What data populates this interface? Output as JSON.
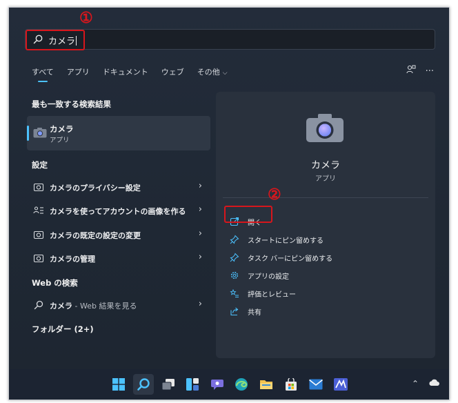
{
  "search": {
    "query": "カメラ"
  },
  "annotations": {
    "step1": "①",
    "step2": "②"
  },
  "tabs": [
    {
      "label": "すべて",
      "active": true
    },
    {
      "label": "アプリ"
    },
    {
      "label": "ドキュメント"
    },
    {
      "label": "ウェブ"
    },
    {
      "label": "その他",
      "has_chevron": true
    }
  ],
  "toolbar_icons": [
    "account-switch-icon",
    "more-icon"
  ],
  "sections": {
    "best_match_title": "最も一致する検索結果",
    "settings_title": "設定",
    "web_title": "Web の検索",
    "folders_title": "フォルダー (2+)"
  },
  "best_match": {
    "name": "カメラ",
    "type": "アプリ",
    "icon": "camera-icon"
  },
  "settings_items": [
    {
      "bold": "カメラ",
      "rest": "のプライバシー設定",
      "icon": "camera-small-icon"
    },
    {
      "bold": "カメラ",
      "rest": "を使ってアカウントの画像を作る",
      "icon": "account-list-icon"
    },
    {
      "bold": "カメラ",
      "rest": "の既定の設定の変更",
      "icon": "camera-small-icon"
    },
    {
      "bold": "カメラ",
      "rest": "の管理",
      "icon": "camera-small-icon"
    }
  ],
  "web_item": {
    "bold": "カメラ",
    "rest": " - Web 結果を見る",
    "icon": "search-icon"
  },
  "detail": {
    "name": "カメラ",
    "type": "アプリ",
    "actions": [
      {
        "label": "開く",
        "icon": "open-icon"
      },
      {
        "label": "スタートにピン留めする",
        "icon": "pin-icon"
      },
      {
        "label": "タスク バーにピン留めする",
        "icon": "pin-icon"
      },
      {
        "label": "アプリの設定",
        "icon": "gear-icon"
      },
      {
        "label": "評価とレビュー",
        "icon": "star-icon"
      },
      {
        "label": "共有",
        "icon": "share-icon"
      }
    ]
  },
  "taskbar": {
    "icons": [
      "windows-start-icon",
      "search-icon",
      "task-view-icon",
      "widgets-icon",
      "teams-chat-icon",
      "edge-icon",
      "file-explorer-icon",
      "store-icon",
      "mail-icon",
      "app-icon"
    ],
    "tray": [
      "chevron-up-icon",
      "onedrive-icon"
    ]
  },
  "colors": {
    "accent": "#4cc2ff",
    "annotation": "#d8161c",
    "panel_bg": "#222b38"
  }
}
